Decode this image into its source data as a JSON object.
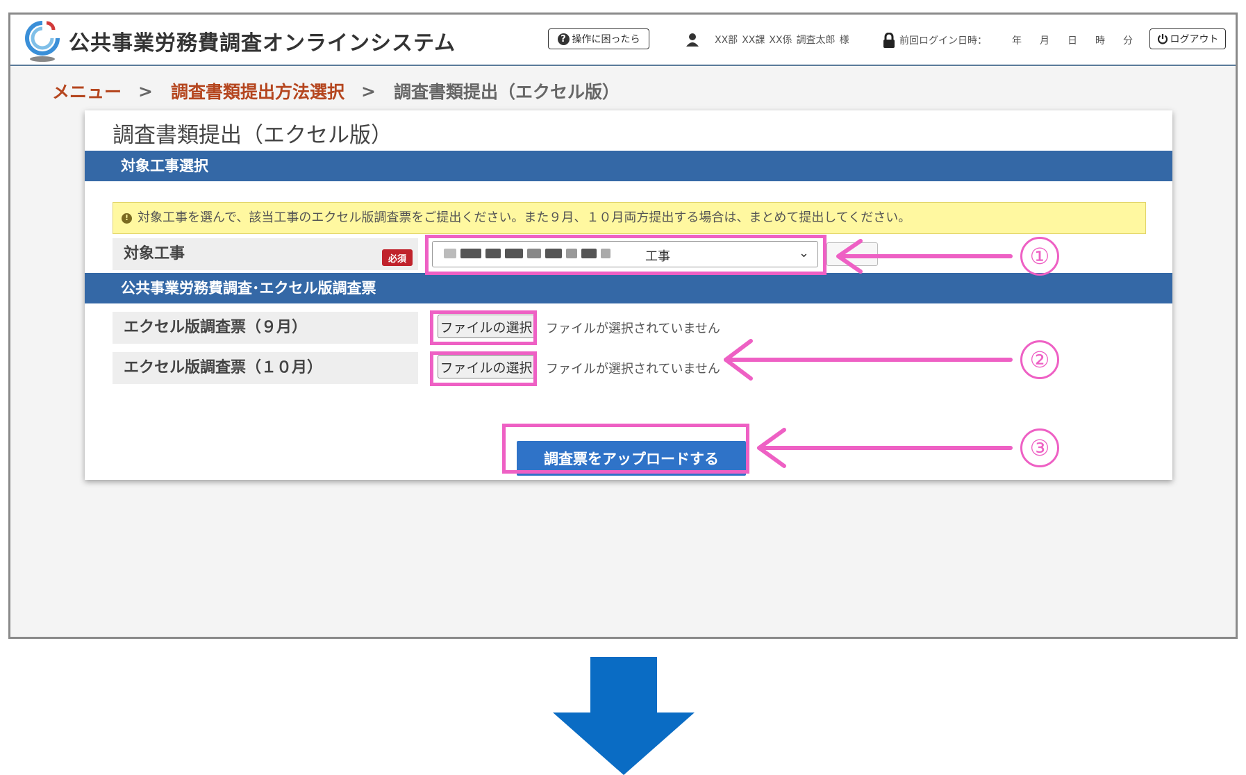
{
  "header": {
    "title": "公共事業労務費調査オンラインシステム",
    "help_label": "操作に困ったら",
    "user": {
      "dept": "XX部",
      "section": "XX課",
      "team": "XX係",
      "name": "調査太郎",
      "honorific": "様"
    },
    "last_login_label": "前回ログイン日時：",
    "last_login_units": [
      "年",
      "月",
      "日",
      "時",
      "分"
    ],
    "logout_label": "ログアウト"
  },
  "breadcrumb": {
    "items": [
      "メニュー",
      "調査書類提出方法選択",
      "調査書類提出（エクセル版）"
    ],
    "separator": ">"
  },
  "page": {
    "title": "調査書類提出（エクセル版）",
    "section1_title": "対象工事選択",
    "notice": "対象工事を選んで、該当工事のエクセル版調査票をご提出ください。また９月、１０月両方提出する場合は、まとめて提出してください。",
    "target_label": "対象工事",
    "required_badge": "必須",
    "select_value": "工事",
    "section2_title": "公共事業労務費調査･エクセル版調査票",
    "file_rows": [
      {
        "label": "エクセル版調査票（９月）",
        "button": "ファイルの選択",
        "status": "ファイルが選択されていません"
      },
      {
        "label": "エクセル版調査票（１０月）",
        "button": "ファイルの選択",
        "status": "ファイルが選択されていません"
      }
    ],
    "upload_label": "調査票をアップロードする"
  },
  "annotations": {
    "callouts": [
      "①",
      "②",
      "③"
    ],
    "highlight_color": "#ee60c4"
  },
  "colors": {
    "section_bar": "#3468a6",
    "upload_button": "#2f73c8",
    "breadcrumb_link": "#b5461f",
    "required_badge": "#c0232c",
    "down_arrow": "#0a6cc4"
  }
}
